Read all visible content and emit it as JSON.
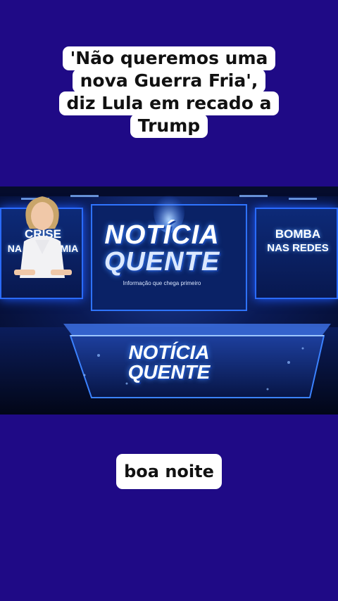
{
  "headline": {
    "lines": [
      "'Não queremos uma",
      "nova Guerra Fria',",
      "diz Lula em recado a",
      "Trump"
    ]
  },
  "scene": {
    "left_panel": [
      "CRISE",
      "NA ECONOMIA"
    ],
    "right_panel": [
      "BOMBA",
      "NAS REDES"
    ],
    "brand_line1": "NOTÍCIA",
    "brand_line2": "QUENTE",
    "tagline": "Informação que chega primeiro",
    "desk_line1": "NOTÍCIA",
    "desk_line2": "QUENTE"
  },
  "caption": "boa noite",
  "colors": {
    "background": "#1f0a86",
    "caption_bg": "#ffffff",
    "studio_glow": "#2a6bff"
  }
}
